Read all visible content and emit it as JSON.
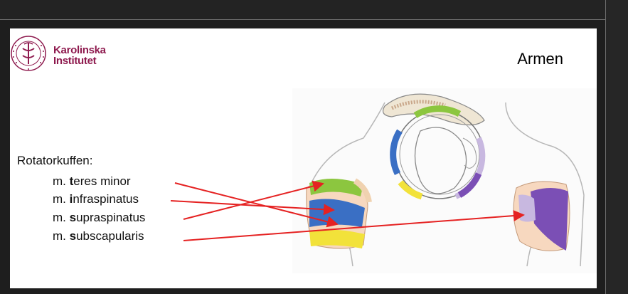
{
  "slide": {
    "title": "Armen",
    "logo": {
      "line1": "Karolinska",
      "line2": "Institutet",
      "seal_text": "KAROLINSKA INSTITUTET · ANNO 1810"
    },
    "rotator_cuff": {
      "heading": "Rotatorkuffen:",
      "muscles": [
        {
          "prefix": "m. ",
          "initial": "t",
          "rest": "eres minor"
        },
        {
          "prefix": "m. ",
          "initial": "i",
          "rest": "nfraspinatus"
        },
        {
          "prefix": "m. ",
          "initial": "s",
          "rest": "upraspinatus"
        },
        {
          "prefix": "m. ",
          "initial": "s",
          "rest": "ubscapularis"
        }
      ]
    }
  },
  "colors": {
    "brand": "#8e1a4e",
    "arrow": "#e52222",
    "teres_minor": "#8cc63f",
    "infraspinatus": "#3a6fc4",
    "supraspinatus": "#f2e23a",
    "subscapularis": "#7b4fb5",
    "bone": "#f7d8bf"
  }
}
